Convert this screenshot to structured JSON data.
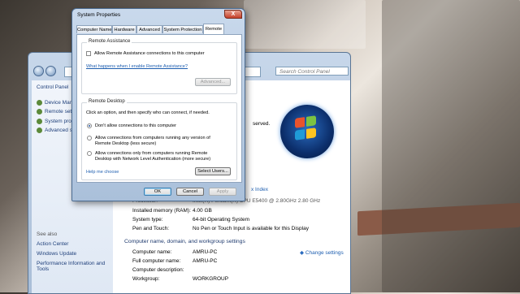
{
  "control_panel": {
    "search_placeholder": "Search Control Panel",
    "sidebar": {
      "home": "Control Panel",
      "items": [
        "Device Manag",
        "Remote settin",
        "System protec",
        "Advanced sys"
      ],
      "see_also_title": "See also",
      "see_also": [
        "Action Center",
        "Windows Update",
        "Performance Information and",
        "Tools"
      ]
    },
    "reserved_text": "served.",
    "experience_index": "x Index",
    "processor_label": "Processor:",
    "processor_value": "Intel(R) Pentium(R) CPU   E5400 @ 2.80GHz   2.80 GHz",
    "rows": [
      {
        "label": "Installed memory (RAM):",
        "value": "4.00 GB"
      },
      {
        "label": "System type:",
        "value": "64-bit Operating System"
      },
      {
        "label": "Pen and Touch:",
        "value": "No Pen or Touch Input is available for this Display"
      }
    ],
    "computer_section_title": "Computer name, domain, and workgroup settings",
    "change_settings": "Change settings",
    "computer_rows": [
      {
        "label": "Computer name:",
        "value": "AMRU-PC"
      },
      {
        "label": "Full computer name:",
        "value": "AMRU-PC"
      },
      {
        "label": "Computer description:",
        "value": ""
      },
      {
        "label": "Workgroup:",
        "value": "WORKGROUP"
      }
    ]
  },
  "dialog": {
    "title": "System Properties",
    "close": "X",
    "tabs": [
      "Computer Name",
      "Hardware",
      "Advanced",
      "System Protection",
      "Remote"
    ],
    "remote_assistance": {
      "title": "Remote Assistance",
      "checkbox_label": "Allow Remote Assistance connections to this computer",
      "help_link": "What happens when I enable Remote Assistance?",
      "advanced_button": "Advanced..."
    },
    "remote_desktop": {
      "title": "Remote Desktop",
      "instruction": "Click an option, and then specify who can connect, if needed.",
      "options": [
        [
          "Don't allow connections to this computer"
        ],
        [
          "Allow connections from computers running any version of",
          "Remote Desktop (less secure)"
        ],
        [
          "Allow connections only from computers running Remote",
          "Desktop with Network Level Authentication (more secure)"
        ]
      ],
      "help_link": "Help me choose",
      "select_users_button": "Select Users..."
    },
    "ok_button": "OK",
    "cancel_button": "Cancel",
    "apply_button": "Apply"
  }
}
